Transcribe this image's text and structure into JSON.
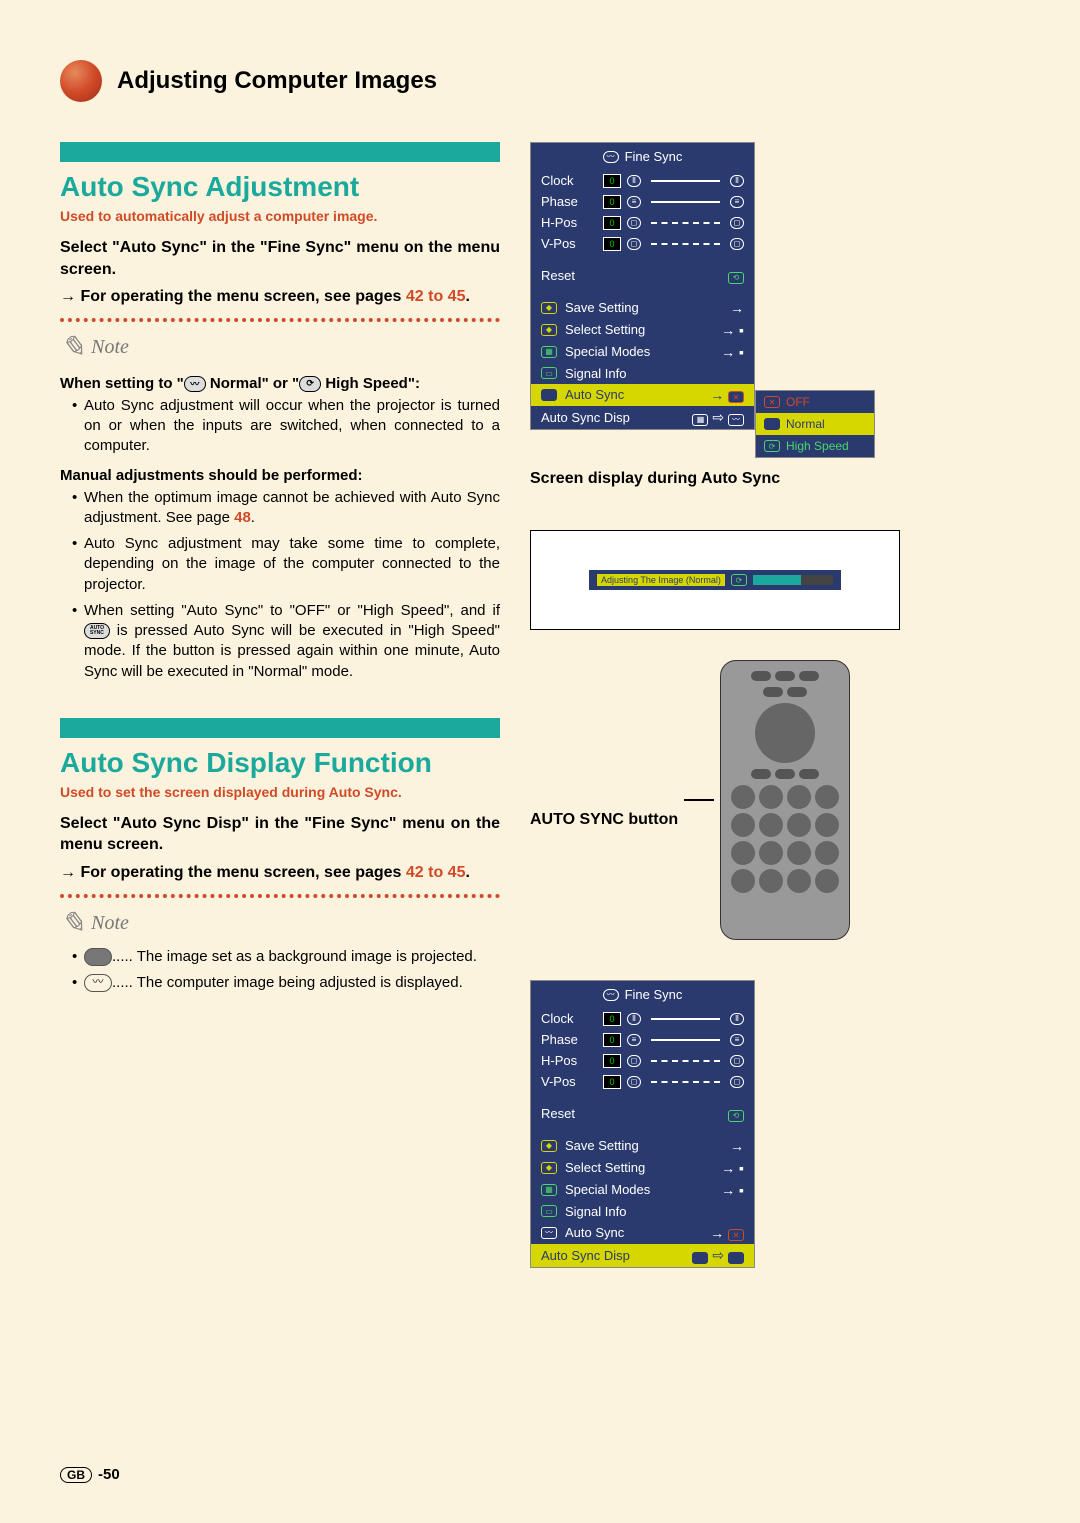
{
  "header": {
    "title": "Adjusting Computer Images"
  },
  "section1": {
    "heading": "Auto Sync Adjustment",
    "sub": "Used to automatically adjust a computer image.",
    "para1": "Select \"Auto Sync\" in the \"Fine Sync\" menu on the menu screen.",
    "para2_prefix": "→ For operating the menu screen, see pages ",
    "pagelink": "42 to 45",
    "note_label": "Note",
    "note_head1_a": "When setting to \"",
    "note_head1_b": " Normal\" or \"",
    "note_head1_c": " High Speed\":",
    "bul1": "Auto Sync adjustment will occur when the projector is turned on or when the inputs are switched, when connected to a computer.",
    "note_head2": "Manual adjustments should be performed:",
    "bul2a_a": "When the optimum image cannot be achieved with Auto Sync adjustment. See page ",
    "bul2a_link": "48",
    "bul2a_b": ".",
    "bul2b": "Auto Sync adjustment may take some time to complete, depending on the image of the computer connected to the projector.",
    "bul2c": "When setting \"Auto Sync\" to \"OFF\" or \"High Speed\", and if  is pressed Auto Sync will be executed in \"High Speed\" mode. If the button is pressed again within one minute, Auto Sync will be executed in \"Normal\" mode.",
    "bul2c_iconlabel": "AUTO SYNC"
  },
  "section2": {
    "heading": "Auto Sync Display Function",
    "sub": "Used to set the screen displayed during Auto Sync.",
    "para1": "Select \"Auto Sync Disp\" in the \"Fine Sync\" menu on the menu screen.",
    "para2_prefix": "→ For operating the menu screen, see pages ",
    "pagelink": "42 to 45",
    "note_label": "Note",
    "li1": "..... The image set as a background image is projected.",
    "li2": "..... The computer image being adjusted is displayed."
  },
  "osd1": {
    "title": "Fine Sync",
    "rows": [
      "Clock",
      "Phase",
      "H-Pos",
      "V-Pos"
    ],
    "vals": [
      "0",
      "0",
      "0",
      "0"
    ],
    "reset": "Reset",
    "items": [
      "Save Setting",
      "Select Setting",
      "Special Modes",
      "Signal Info",
      "Auto Sync",
      "Auto Sync Disp"
    ],
    "highlight_index": 4,
    "side_options": [
      "OFF",
      "Normal",
      "High Speed"
    ],
    "side_selected": 1
  },
  "screen_display": {
    "caption": "Screen display during Auto Sync",
    "chip": "Adjusting The Image (Normal)",
    "button_caption": "AUTO SYNC button"
  },
  "osd2": {
    "title": "Fine Sync",
    "rows": [
      "Clock",
      "Phase",
      "H-Pos",
      "V-Pos"
    ],
    "vals": [
      "0",
      "0",
      "0",
      "0"
    ],
    "reset": "Reset",
    "items": [
      "Save Setting",
      "Select Setting",
      "Special Modes",
      "Signal Info",
      "Auto Sync",
      "Auto Sync Disp"
    ],
    "highlight_index": 5
  },
  "footer": {
    "gb": "GB",
    "page": "-50"
  }
}
